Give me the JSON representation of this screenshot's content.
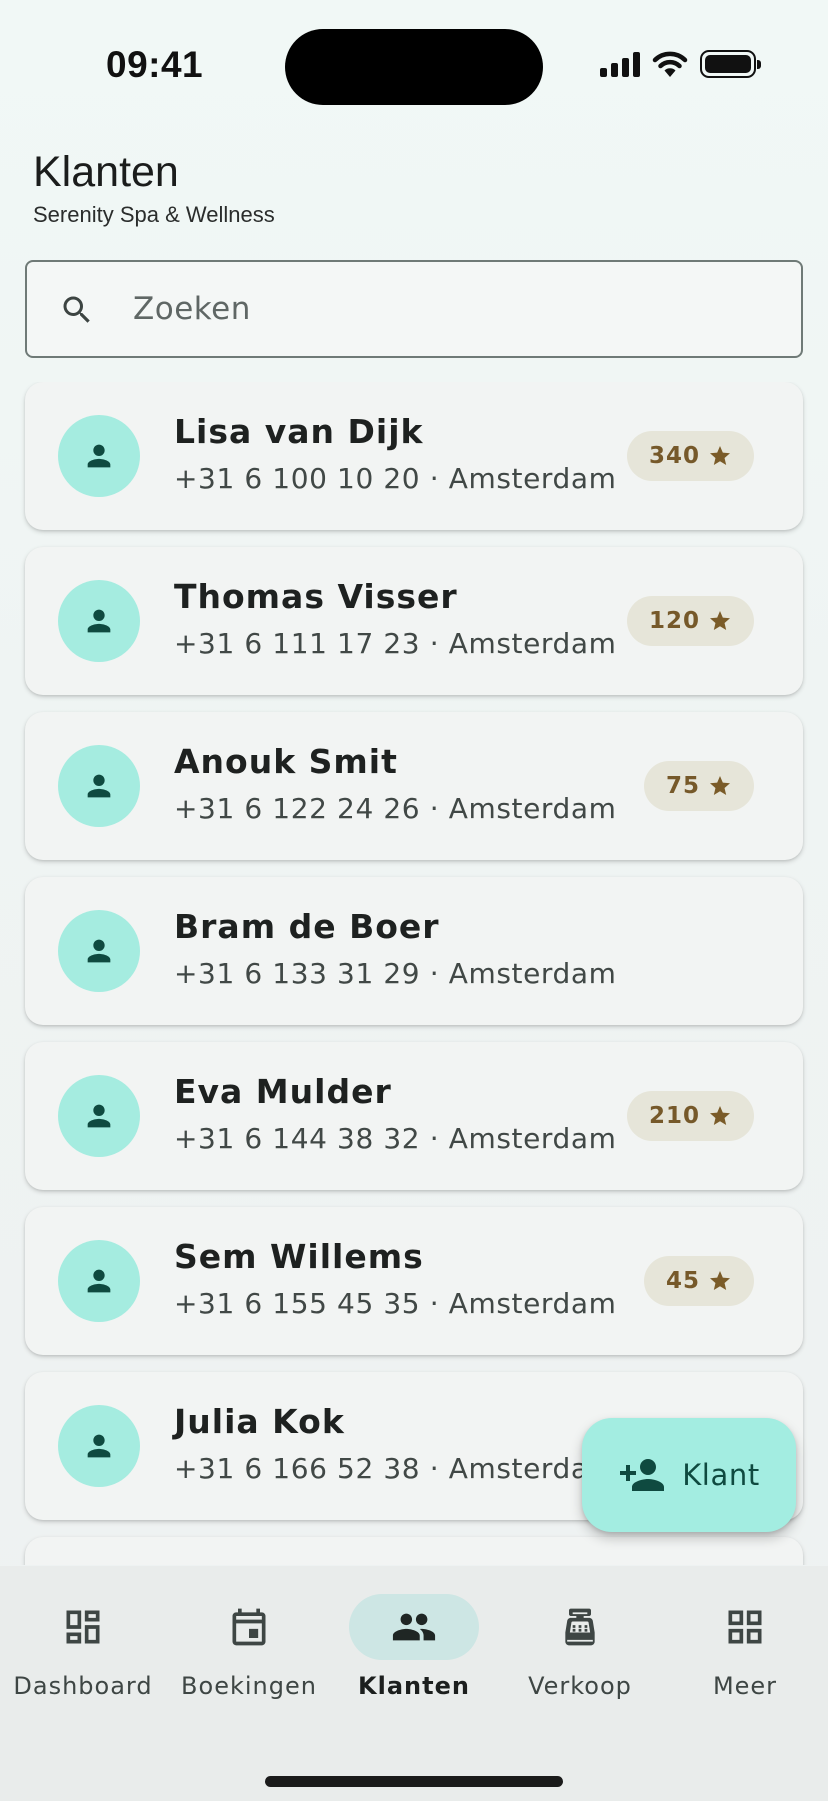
{
  "status_bar": {
    "time": "09:41"
  },
  "header": {
    "title": "Klanten",
    "subtitle": "Serenity Spa & Wellness"
  },
  "search": {
    "placeholder": "Zoeken",
    "value": ""
  },
  "clients": [
    {
      "name": "Lisa van Dijk",
      "meta": "+31 6 100 10 20 · Amsterdam",
      "points": "340"
    },
    {
      "name": "Thomas Visser",
      "meta": "+31 6 111 17 23 · Amsterdam",
      "points": "120"
    },
    {
      "name": "Anouk Smit",
      "meta": "+31 6 122 24 26 · Amsterdam",
      "points": "75"
    },
    {
      "name": "Bram de Boer",
      "meta": "+31 6 133 31 29 · Amsterdam",
      "points": ""
    },
    {
      "name": "Eva Mulder",
      "meta": "+31 6 144 38 32 · Amsterdam",
      "points": "210"
    },
    {
      "name": "Sem Willems",
      "meta": "+31 6 155 45 35 · Amsterdam",
      "points": "45"
    },
    {
      "name": "Julia Kok",
      "meta": "+31 6 166 52 38 · Amsterdam",
      "points": ""
    },
    {
      "name": "",
      "meta": "",
      "points": ""
    }
  ],
  "fab": {
    "label": "Klant",
    "icon": "person-add-icon"
  },
  "nav": {
    "items": [
      {
        "label": "Dashboard",
        "icon": "dashboard-icon"
      },
      {
        "label": "Boekingen",
        "icon": "calendar-icon"
      },
      {
        "label": "Klanten",
        "icon": "people-icon"
      },
      {
        "label": "Verkoop",
        "icon": "register-icon"
      },
      {
        "label": "Meer",
        "icon": "grid-icon"
      }
    ],
    "active": "Klanten"
  },
  "colors": {
    "accent": "#a5ece0",
    "icon_dark": "#0f4a40",
    "badge_bg": "#e6e5d9",
    "badge_text": "#76592a",
    "nav_active_pill": "#cde6e4"
  }
}
